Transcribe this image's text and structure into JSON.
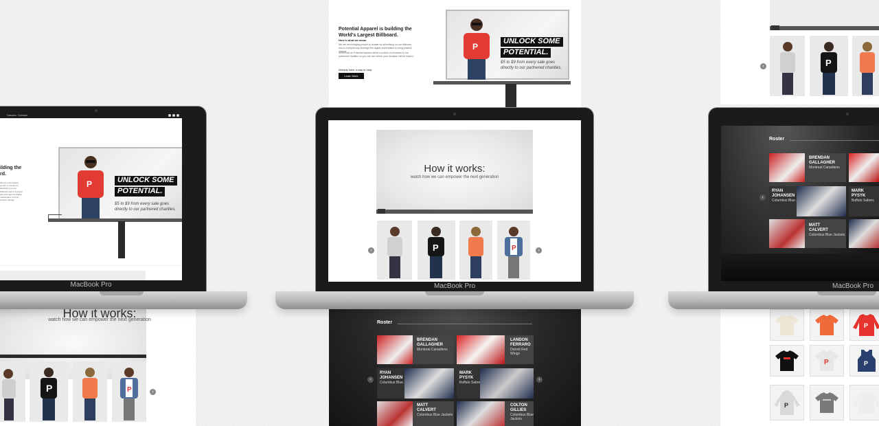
{
  "laptops": {
    "label": "MacBook Pro"
  },
  "billboard": {
    "intro_title": "Potential Apparel is building the World's Largest Billboard.",
    "partial_title": "ilding the",
    "partial_title_2": "rd.",
    "intro_link": "Here's what we mean",
    "intro_body": "We are encouraging people to donate by advertising on our billboard and in a playful way leverage the digital marketplace to bring positive change.",
    "intro_body_2": "Shirts sold on Potential Apparel direct a portion of proceeds to our partnered charities so you can see where your donation will be shared.",
    "cta_prompt": "Already have a way to help:",
    "learn_more": "Learn More",
    "headline_1": "UNLOCK SOME",
    "headline_2": "POTENTIAL.",
    "tagline_1": "$5 to $9 from every sale goes",
    "tagline_2": "directly to our partnered charities."
  },
  "video": {
    "title": "How it works:",
    "subtitle": "watch how we can empower the next generation"
  },
  "nav": {
    "item_1": "Causes",
    "item_2": "Contact"
  },
  "roster": {
    "title": "Roster",
    "players": [
      {
        "first": "BRENDAN",
        "last": "GALLAGHER",
        "team": "Montreal Canadiens"
      },
      {
        "first": "LANDON",
        "last": "FERRARO",
        "team": "Detroit Red Wings"
      },
      {
        "first": "RYAN",
        "last": "JOHANSEN",
        "team": "Columbus Blue Jackets"
      },
      {
        "first": "MARK",
        "last": "PYSYK",
        "team": "Buffalo Sabres"
      },
      {
        "first": "MATT",
        "last": "CALVERT",
        "team": "Columbus Blue Jackets"
      },
      {
        "first": "COLTON",
        "last": "GILLIES",
        "team": "Columbus Blue Jackets"
      }
    ]
  },
  "colors": {
    "accent": "#ec6a4a",
    "red": "#e8342e",
    "navy": "#1f2d4e",
    "dark": "#1b1b1b"
  },
  "icons": [
    "play-icon",
    "chevron-left-icon",
    "chevron-right-icon",
    "facebook-icon",
    "twitter-icon",
    "instagram-icon"
  ]
}
